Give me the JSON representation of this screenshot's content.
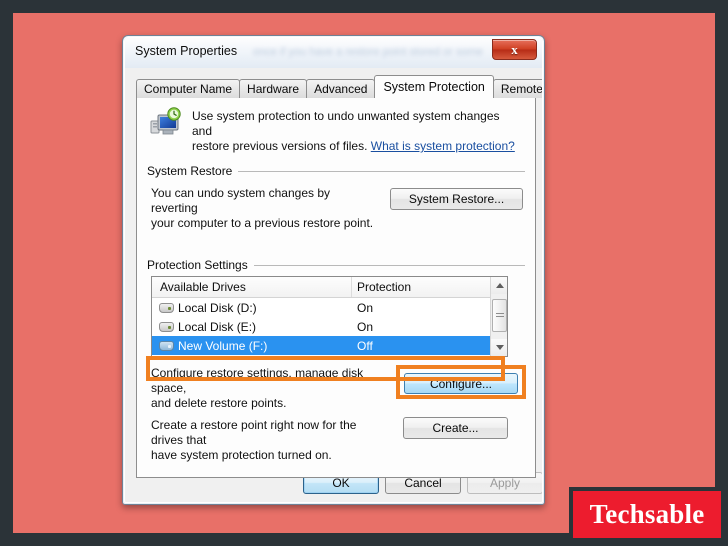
{
  "backdrop": {
    "frame_color": "#2b3338",
    "fill_color": "#e87068"
  },
  "watermark": {
    "text": "Techsable",
    "bg_color": "#ed1c2e",
    "text_color": "#ffffff"
  },
  "dialog": {
    "title": "System Properties",
    "ghost_title_text": "once if you have a restore point stored or something",
    "close_label": "x"
  },
  "tabs": [
    {
      "label": "Computer Name",
      "active": false
    },
    {
      "label": "Hardware",
      "active": false
    },
    {
      "label": "Advanced",
      "active": false
    },
    {
      "label": "System Protection",
      "active": true
    },
    {
      "label": "Remote",
      "active": false
    }
  ],
  "intro": {
    "icon_name": "system-protection-icon",
    "line1": "Use system protection to undo unwanted system changes and",
    "line2": "restore previous versions of files. ",
    "link_text": "What is system protection?"
  },
  "system_restore": {
    "group_label": "System Restore",
    "description_line1": "You can undo system changes by reverting",
    "description_line2": "your computer to a previous restore point.",
    "button_label": "System Restore..."
  },
  "protection_settings": {
    "group_label": "Protection Settings",
    "columns": [
      "Available Drives",
      "Protection"
    ],
    "rows": [
      {
        "drive": "Local Disk (D:)",
        "protection": "On",
        "selected": false
      },
      {
        "drive": "Local Disk (E:)",
        "protection": "On",
        "selected": false
      },
      {
        "drive": "New Volume (F:)",
        "protection": "Off",
        "selected": true
      }
    ],
    "highlight_color": "#f08020",
    "selection_color": "#2a92f0"
  },
  "configure": {
    "description_line1": "Configure restore settings, manage disk space,",
    "description_line2": "and delete restore points.",
    "button_label": "Configure...",
    "highlighted": true
  },
  "create": {
    "description_line1": "Create a restore point right now for the drives that",
    "description_line2": "have system protection turned on.",
    "button_label": "Create..."
  },
  "footer": {
    "ok_label": "OK",
    "cancel_label": "Cancel",
    "apply_label": "Apply",
    "apply_disabled": true
  }
}
